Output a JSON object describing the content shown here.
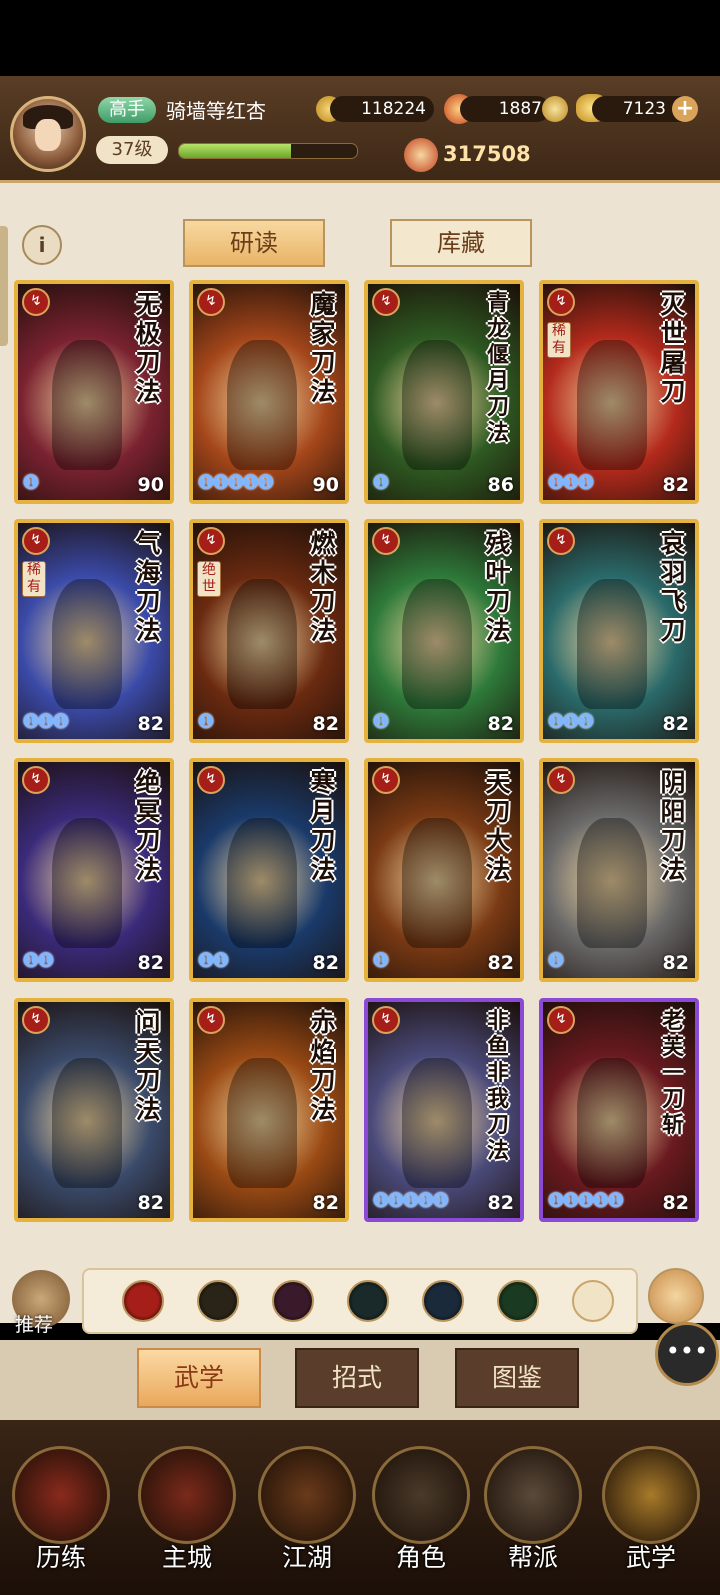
{
  "player": {
    "rank": "高手",
    "name": "骑墙等红杏",
    "level": "37级",
    "xp_fraction": 0.63,
    "power": "317508"
  },
  "currencies": [
    {
      "name": "coins",
      "value": "118224",
      "icon": "coin-icon",
      "color": "#d9a53a"
    },
    {
      "name": "flame",
      "value": "1887",
      "icon": "flame-icon",
      "color": "#e06a28"
    },
    {
      "name": "gold",
      "value": "7123",
      "icon": "gold-ingot-icon",
      "color": "#e6b83a"
    }
  ],
  "tabs": {
    "study": "研读",
    "collection": "库藏"
  },
  "cards": [
    {
      "title": "无极刀法",
      "level": "90",
      "drops": "❶",
      "tag": "",
      "border": "gold",
      "bg": "#7a2230"
    },
    {
      "title": "魔家刀法",
      "level": "90",
      "drops": "❶❶❶❶❶",
      "tag": "",
      "border": "gold",
      "bg": "#a4461a"
    },
    {
      "title": "青龙偃月刀法",
      "level": "86",
      "drops": "❶",
      "tag": "",
      "border": "gold",
      "bg": "#2e5a22"
    },
    {
      "title": "灭世屠刀",
      "level": "82",
      "drops": "❶❶❶",
      "tag": "稀有",
      "border": "gold",
      "bg": "#b32a1c"
    },
    {
      "title": "气海刀法",
      "level": "82",
      "drops": "❶❶❶",
      "tag": "稀有",
      "border": "gold",
      "bg": "#3a4aa8"
    },
    {
      "title": "燃木刀法",
      "level": "82",
      "drops": "❶",
      "tag": "绝世",
      "border": "gold",
      "bg": "#6a2a10"
    },
    {
      "title": "残叶刀法",
      "level": "82",
      "drops": "❶",
      "tag": "",
      "border": "gold",
      "bg": "#2e7a3a"
    },
    {
      "title": "哀羽飞刀",
      "level": "82",
      "drops": "❶❶❶",
      "tag": "",
      "border": "gold",
      "bg": "#2a6a6a"
    },
    {
      "title": "绝冥刀法",
      "level": "82",
      "drops": "❶❶",
      "tag": "",
      "border": "gold",
      "bg": "#3a2a7a"
    },
    {
      "title": "寒月刀法",
      "level": "82",
      "drops": "❶❶",
      "tag": "",
      "border": "gold",
      "bg": "#1a3a6a"
    },
    {
      "title": "天刀大法",
      "level": "82",
      "drops": "❶",
      "tag": "",
      "border": "gold",
      "bg": "#7a3a14"
    },
    {
      "title": "阴阳刀法",
      "level": "82",
      "drops": "❶",
      "tag": "",
      "border": "gold",
      "bg": "#6a6a6a"
    },
    {
      "title": "问天刀法",
      "level": "82",
      "drops": "",
      "tag": "",
      "border": "gold",
      "bg": "#3a4a6a"
    },
    {
      "title": "赤焰刀法",
      "level": "82",
      "drops": "",
      "tag": "",
      "border": "gold",
      "bg": "#9a4a14"
    },
    {
      "title": "非鱼非我刀法",
      "level": "82",
      "drops": "❶❶❶❶❶",
      "tag": "",
      "border": "purple",
      "bg": "#4a4a7a"
    },
    {
      "title": "老芙一刀斩",
      "level": "82",
      "drops": "❶❶❶❶❶",
      "tag": "",
      "border": "purple",
      "bg": "#6a1a20"
    }
  ],
  "filters": {
    "recommend": "推荐",
    "colors": [
      "#a51f18",
      "#2a2418",
      "#3a1a2a",
      "#1a2a2a",
      "#1a2a3a",
      "#1a3a22"
    ]
  },
  "subtabs": [
    "武学",
    "招式",
    "图鉴"
  ],
  "nav": [
    "历练",
    "主城",
    "江湖",
    "角色",
    "帮派",
    "武学"
  ]
}
